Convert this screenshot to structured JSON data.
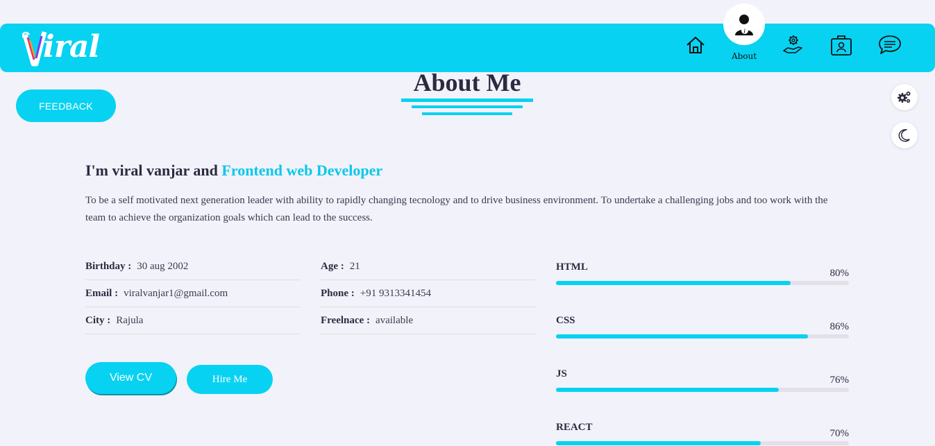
{
  "brand": {
    "logo_text": "iral"
  },
  "nav": {
    "items": [
      {
        "name": "home",
        "icon": "home-icon"
      },
      {
        "name": "about",
        "icon": "user-info-icon",
        "label": "About"
      },
      {
        "name": "services",
        "icon": "gear-hand-icon"
      },
      {
        "name": "portfolio",
        "icon": "id-badge-icon"
      },
      {
        "name": "contact",
        "icon": "chat-icon"
      }
    ],
    "active_label": "About"
  },
  "feedback_label": "FEEDBACK",
  "page_title": "About Me",
  "headline": {
    "prefix": "I'm viral vanjar and ",
    "accent": "Frontend web Developer"
  },
  "bio": "To be a self motivated next generation leader with ability to rapidly changing tecnology and to drive business environment. To undertake a challenging jobs and too work with the team to achieve the organization goals which can lead to the success.",
  "info_left": [
    {
      "label": "Birthday :",
      "value": "30 aug 2002"
    },
    {
      "label": "Email :",
      "value": "viralvanjar1@gmail.com"
    },
    {
      "label": "City :",
      "value": "Rajula"
    }
  ],
  "info_right": [
    {
      "label": "Age :",
      "value": "21"
    },
    {
      "label": "Phone :",
      "value": "+91 9313341454"
    },
    {
      "label": "Freelnace :",
      "value": "available"
    }
  ],
  "buttons": {
    "view_cv": "View CV",
    "hire_me": "Hire Me"
  },
  "skills": [
    {
      "name": "HTML",
      "percent_label": "80%",
      "level": 0.8
    },
    {
      "name": "CSS",
      "percent_label": "86%",
      "level": 0.86
    },
    {
      "name": "JS",
      "percent_label": "76%",
      "level": 0.76
    },
    {
      "name": "REACT",
      "percent_label": "70%",
      "level": 0.7
    }
  ],
  "colors": {
    "accent": "#08d2f1",
    "text": "#2d2a40",
    "background": "#f2f2fb"
  }
}
